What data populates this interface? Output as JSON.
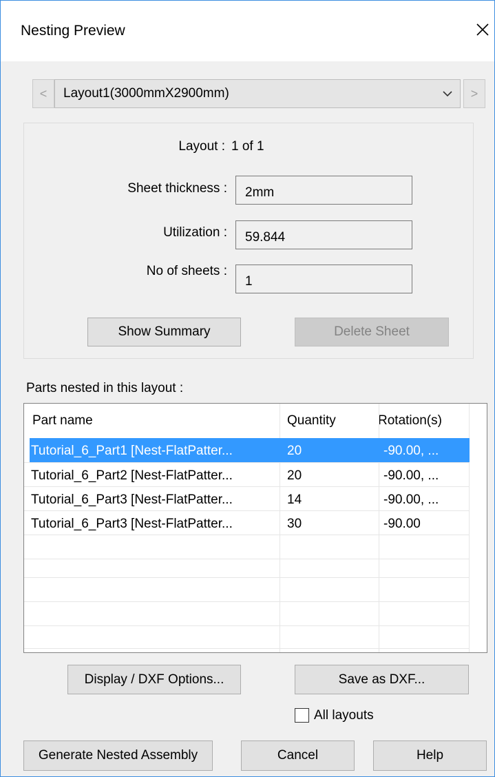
{
  "window": {
    "title": "Nesting Preview"
  },
  "navigator": {
    "prev": "<",
    "next": ">",
    "selected_layout": "Layout1(3000mmX2900mm)"
  },
  "info": {
    "layout_label": "Layout :",
    "layout_value": "1 of 1",
    "thickness_label": "Sheet thickness :",
    "thickness_value": "2mm",
    "utilization_label": "Utilization :",
    "utilization_value": "59.844",
    "sheets_label": "No of sheets :",
    "sheets_value": "1",
    "show_summary": "Show Summary",
    "delete_sheet": "Delete Sheet"
  },
  "parts": {
    "caption": "Parts nested in this layout :",
    "columns": [
      "Part name",
      "Quantity",
      "Rotation(s)"
    ],
    "rows": [
      {
        "name": "Tutorial_6_Part1 [Nest-FlatPatter...",
        "qty": "20",
        "rot": "-90.00, ...",
        "selected": true
      },
      {
        "name": "Tutorial_6_Part2 [Nest-FlatPatter...",
        "qty": "20",
        "rot": "-90.00, ..."
      },
      {
        "name": "Tutorial_6_Part3 [Nest-FlatPatter...",
        "qty": "14",
        "rot": "-90.00, ..."
      },
      {
        "name": "Tutorial_6_Part3 [Nest-FlatPatter...",
        "qty": "30",
        "rot": "-90.00"
      }
    ]
  },
  "actions": {
    "display_options": "Display / DXF Options...",
    "save_dxf": "Save as DXF...",
    "all_layouts": "All layouts",
    "all_layouts_checked": false,
    "generate": "Generate Nested Assembly",
    "cancel": "Cancel",
    "help": "Help"
  },
  "colors": {
    "selection": "#3399ff",
    "window_border": "#3c8de0",
    "background": "#f0f0f0"
  }
}
